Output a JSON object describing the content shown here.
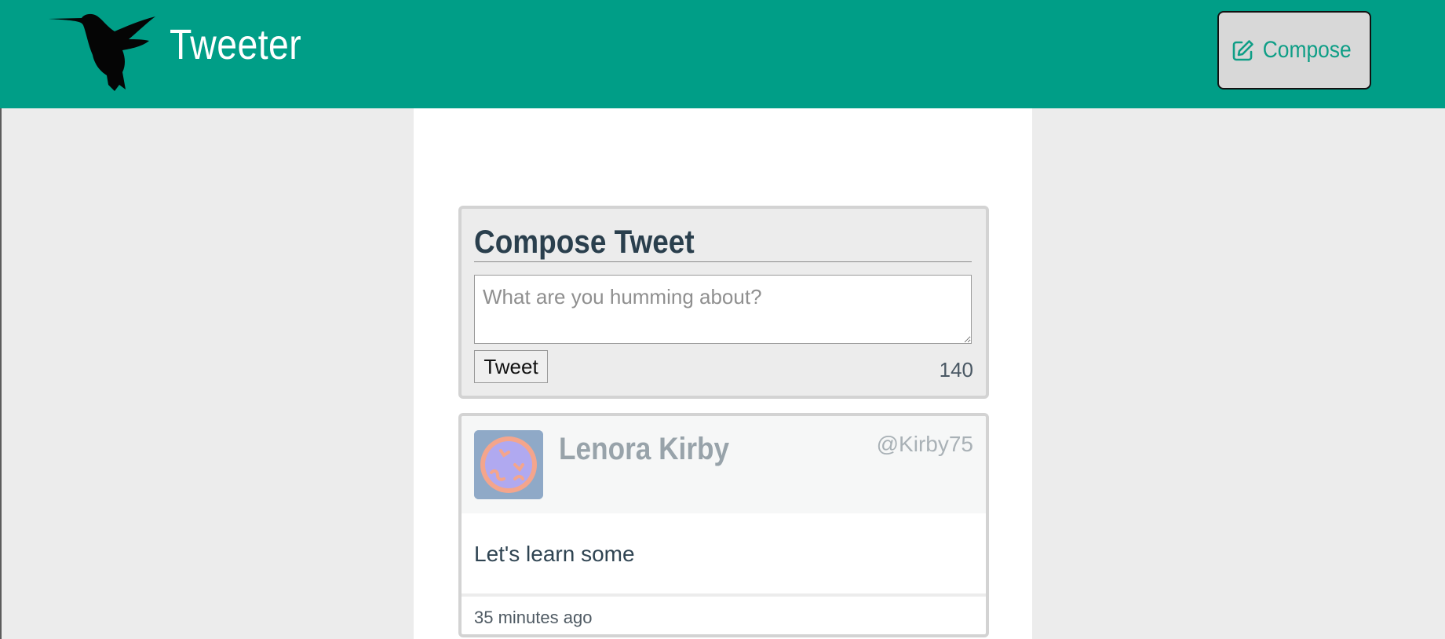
{
  "header": {
    "brand": "Tweeter",
    "compose_label": "Compose",
    "colors": {
      "bar": "#009e87",
      "compose_text": "#0e9e86"
    },
    "icons": {
      "logo": "hummingbird-logo",
      "compose": "pencil-square-icon"
    }
  },
  "compose": {
    "title": "Compose Tweet",
    "placeholder": "What are you humming about?",
    "value": "",
    "submit_label": "Tweet",
    "counter": "140"
  },
  "tweets": [
    {
      "name": "Lenora Kirby",
      "handle": "@Kirby75",
      "body": "Let's learn some",
      "time": "35 minutes ago"
    }
  ]
}
